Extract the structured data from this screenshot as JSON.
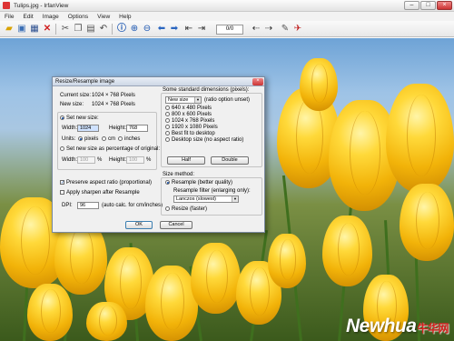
{
  "window": {
    "title": "Tulips.jpg - IrfanView",
    "buttons": [
      "–",
      "□",
      "×"
    ]
  },
  "menu": [
    "File",
    "Edit",
    "Image",
    "Options",
    "View",
    "Help"
  ],
  "toolbar": {
    "page_field": "0/0",
    "icons": [
      "open-icon",
      "slideshow-icon",
      "save-icon",
      "delete-icon",
      "cut-icon",
      "copy-icon",
      "paste-icon",
      "undo-icon",
      "info-icon",
      "zoom-in-icon",
      "zoom-out-icon",
      "prev-icon",
      "next-icon",
      "first-page-icon",
      "last-page-icon",
      "settings-icon",
      "exit-icon"
    ]
  },
  "dialog": {
    "title": "Resize/Resample image",
    "current_size_label": "Current size:",
    "current_size_value": "1024 × 768  Pixels",
    "new_size_label": "New size:",
    "new_size_value": "1024 × 768  Pixels",
    "set_new_size": "Set new size:",
    "width_label": "Width:",
    "width_value": "1024",
    "height_label": "Height:",
    "height_value": "768",
    "units_label": "Units:",
    "units": [
      "pixels",
      "cm",
      "inches"
    ],
    "set_percentage": "Set new size as percentage of original:",
    "pct_width_label": "Width:",
    "pct_width_value": "100",
    "pct_height_label": "Height:",
    "pct_height_value": "100",
    "pct_unit": "%",
    "preserve_aspect": "Preserve aspect ratio (proportional)",
    "apply_sharpen": "Apply sharpen after Resample",
    "dpi_label": "DPI:",
    "dpi_value": "96",
    "dpi_hint": "(auto calc. for cm/inches)",
    "std_dims_label": "Some standard dimensions (pixels):",
    "std_select_value": "New size",
    "std_select_hint": "(ratio option unset)",
    "std_options": [
      "640 x 480 Pixels",
      "800 x 600 Pixels",
      "1024 x 768 Pixels",
      "1920 x 1080 Pixels",
      "Best fit to desktop",
      "Desktop size (no aspect ratio)"
    ],
    "half_button": "Half",
    "double_button": "Double",
    "size_method_label": "Size method:",
    "resample_label": "Resample (better quality)",
    "resample_filter_label": "Resample filter (enlarging only):",
    "filter_value": "Lanczos (slowest)",
    "resize_label": "Resize (faster)",
    "ok_button": "OK",
    "cancel_button": "Cancel"
  },
  "watermark": {
    "text": "Newhua",
    "cn": "牛华网"
  }
}
